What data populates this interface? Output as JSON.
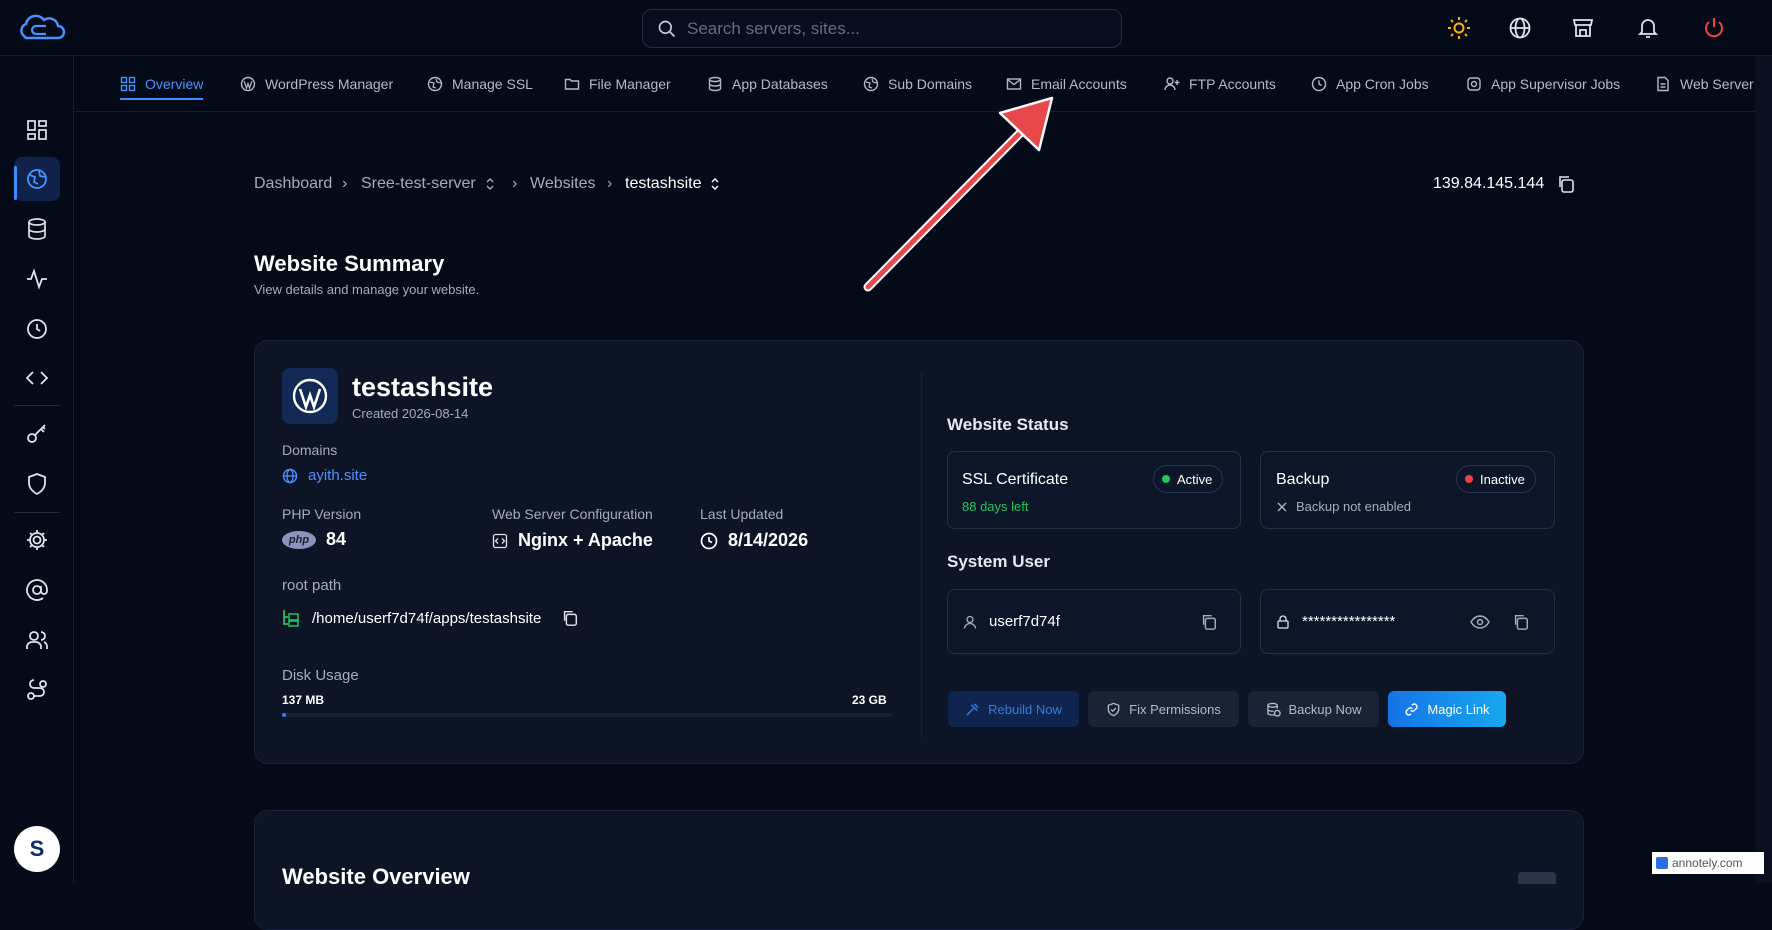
{
  "search": {
    "placeholder": "Search servers, sites..."
  },
  "nav": {
    "tabs": [
      {
        "label": "Overview",
        "icon": "grid-icon"
      },
      {
        "label": "WordPress Manager",
        "icon": "wordpress-icon"
      },
      {
        "label": "Manage SSL",
        "icon": "globe-shield-icon"
      },
      {
        "label": "File Manager",
        "icon": "folder-icon"
      },
      {
        "label": "App Databases",
        "icon": "database-icon"
      },
      {
        "label": "Sub Domains",
        "icon": "globe-icon"
      },
      {
        "label": "Email Accounts",
        "icon": "mail-icon"
      },
      {
        "label": "FTP Accounts",
        "icon": "user-plus-icon"
      },
      {
        "label": "App Cron Jobs",
        "icon": "clock-icon"
      },
      {
        "label": "App Supervisor Jobs",
        "icon": "cog-icon"
      },
      {
        "label": "Web Server Lo",
        "icon": "file-icon"
      }
    ]
  },
  "breadcrumb": {
    "items": [
      "Dashboard",
      "Sree-test-server",
      "Websites",
      "testashsite"
    ]
  },
  "server_ip": "139.84.145.144",
  "page": {
    "title": "Website Summary",
    "subtitle": "View details and manage your website."
  },
  "site": {
    "name": "testashsite",
    "created": "Created 2026-08-14",
    "domains_label": "Domains",
    "domain": "ayith.site",
    "php_label": "PHP Version",
    "php_badge": "php",
    "php_version": "84",
    "webserver_label": "Web Server Configuration",
    "webserver": "Nginx + Apache",
    "updated_label": "Last Updated",
    "updated": "8/14/2026",
    "root_label": "root path",
    "root_path": "/home/userf7d74f/apps/testashsite",
    "disk_label": "Disk Usage",
    "disk_used": "137 MB",
    "disk_total": "23 GB",
    "disk_fraction": 0.006
  },
  "status": {
    "title": "Website Status",
    "ssl_label": "SSL Certificate",
    "ssl_state": "Active",
    "ssl_note": "88 days left",
    "backup_label": "Backup",
    "backup_state": "Inactive",
    "backup_note": "Backup not enabled"
  },
  "system_user": {
    "title": "System User",
    "username": "userf7d74f",
    "password": "****************"
  },
  "actions": {
    "rebuild": "Rebuild Now",
    "fix": "Fix Permissions",
    "backup": "Backup Now",
    "magic": "Magic Link"
  },
  "overview": {
    "title": "Website Overview"
  },
  "avatar": {
    "letter": "S"
  },
  "watermark": "annotely.com",
  "colors": {
    "accent": "#3a8dff",
    "success": "#22c55e",
    "danger": "#ef4444",
    "annotation_arrow": "#e8474c"
  }
}
